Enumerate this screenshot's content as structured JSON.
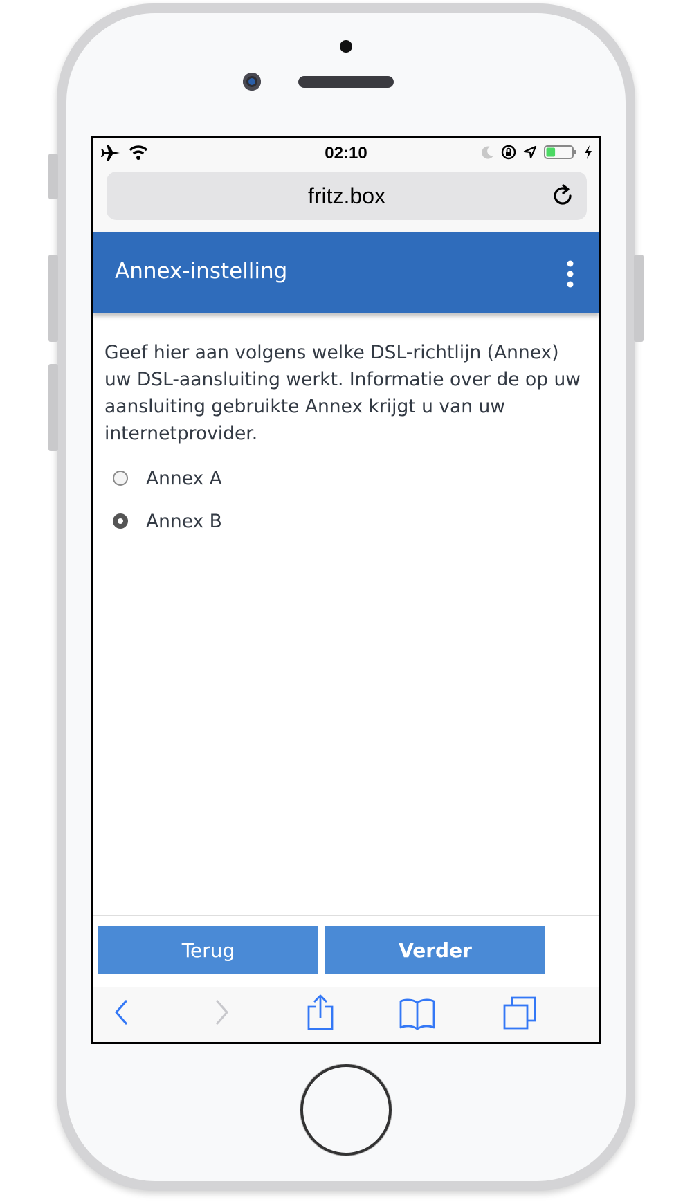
{
  "status_bar": {
    "time": "02:10",
    "icons": [
      "airplane-icon",
      "wifi-icon",
      "moon-icon",
      "orientation-lock-icon",
      "location-icon",
      "battery-icon",
      "charging-icon"
    ],
    "battery_level": 0.35,
    "battery_color": "#4cd964"
  },
  "browser": {
    "url": "fritz.box",
    "toolbar_icons": [
      "back-icon",
      "forward-icon",
      "share-icon",
      "bookmarks-icon",
      "tabs-icon"
    ],
    "accent_color": "#3478f6"
  },
  "app": {
    "header_color": "#2f6cbb",
    "title": "Annex-instelling",
    "description": "Geef hier aan volgens welke DSL-richtlijn (Annex) uw DSL-aansluiting werkt. Informatie over de op uw aansluiting gebruikte Annex krijgt u van uw internetprovider.",
    "options": [
      {
        "label": "Annex A",
        "checked": false
      },
      {
        "label": "Annex B",
        "checked": true
      }
    ],
    "buttons": {
      "back": "Terug",
      "next": "Verder",
      "color": "#4a8ad6"
    }
  }
}
